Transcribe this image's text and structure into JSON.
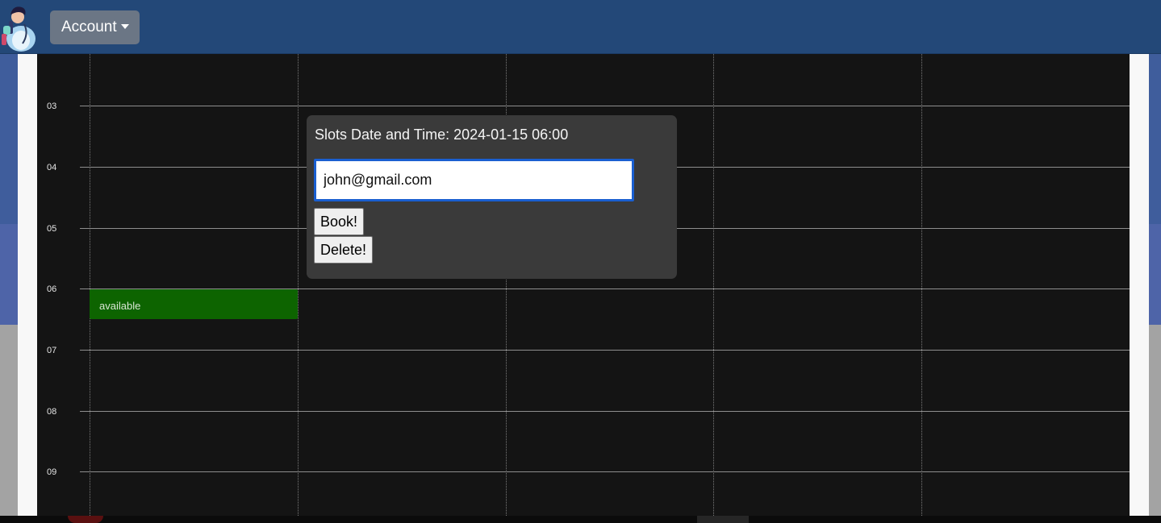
{
  "navbar": {
    "account_label": "Account",
    "background_color": "#234878"
  },
  "calendar": {
    "hours": [
      "03",
      "04",
      "05",
      "06",
      "07",
      "08",
      "09"
    ],
    "event": {
      "label": "available",
      "color": "#0d6400"
    }
  },
  "popup": {
    "title": "Slots Date and Time: 2024-01-15 06:00",
    "email_value": "john@gmail.com",
    "book_label": "Book!",
    "delete_label": "Delete!"
  },
  "icons": {
    "logo": "doctor-avatar-icon",
    "account_caret": "caret-down-icon"
  }
}
